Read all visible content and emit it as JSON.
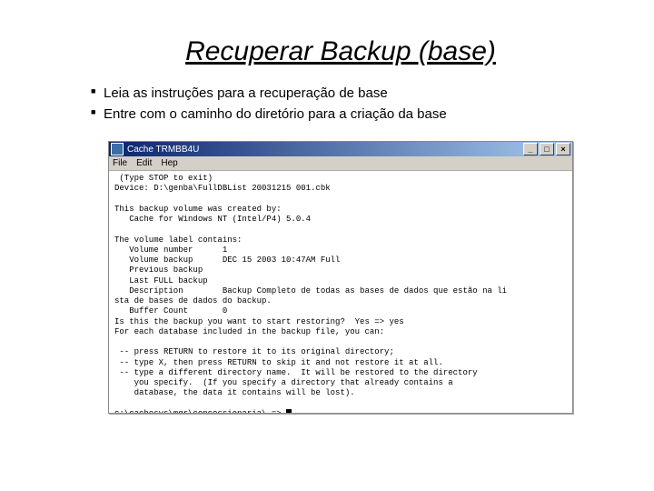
{
  "title": "Recuperar Backup (base)",
  "bullets": [
    "Leia as instruções para a recuperação de base",
    "Entre com o caminho do diretório para a criação da base"
  ],
  "window": {
    "title": "Cache TRMBB4U",
    "buttons": {
      "min": "_",
      "max": "□",
      "close": "×"
    },
    "menu": [
      "File",
      "Edit",
      "Hep"
    ],
    "console_lines": [
      " (Type STOP to exit)",
      "Device: D:\\genba\\FullDBList 20031215 001.cbk",
      "",
      "This backup volume was created by:",
      "   Cache for Windows NT (Intel/P4) 5.0.4",
      "",
      "The volume label contains:",
      "   Volume number      1",
      "   Volume backup      DEC 15 2003 10:47AM Full",
      "   Previous backup",
      "   Last FULL backup",
      "   Description        Backup Completo de todas as bases de dados que estão na li",
      "sta de bases de dados do backup.",
      "   Buffer Count       0",
      "Is this the backup you want to start restoring?  Yes => yes",
      "For each database included in the backup file, you can:",
      "",
      " -- press RETURN to restore it to its original directory;",
      " -- type X, then press RETURN to skip it and not restore it at all.",
      " -- type a different directory name.  It will be restored to the directory",
      "    you specify.  (If you specify a directory that already contains a",
      "    database, the data it contains will be lost).",
      "",
      "c:\\cachesys\\mgr\\concessionaria\\ =>"
    ]
  }
}
